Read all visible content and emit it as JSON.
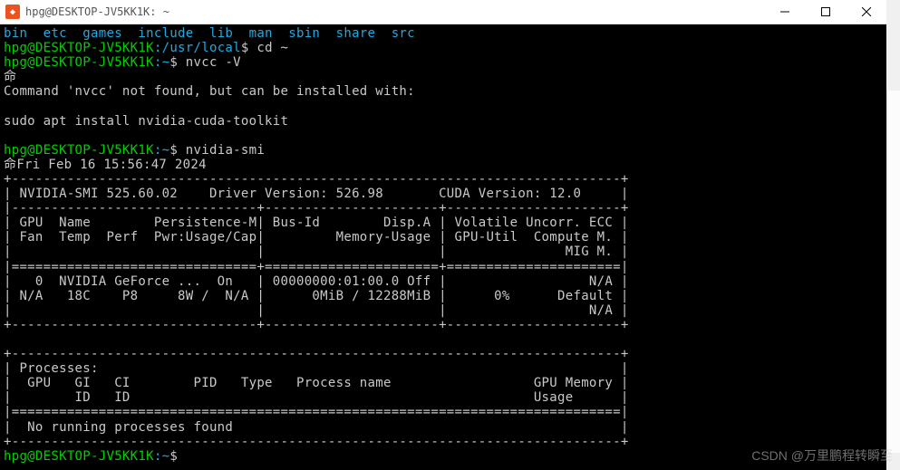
{
  "titlebar": {
    "icon_glyph": "◆",
    "title": "hpg@DESKTOP-JV5KK1K: ~"
  },
  "window_controls": {
    "minimize": "minimize",
    "maximize": "maximize",
    "close": "close"
  },
  "dirs_line": "bin  etc  games  include  lib  man  sbin  share  src",
  "prompts": [
    {
      "user": "hpg@DESKTOP-JV5KK1K",
      "path": ":/usr/local",
      "sep": "$ ",
      "cmd": "cd ~"
    },
    {
      "user": "hpg@DESKTOP-JV5KK1K",
      "path": ":~",
      "sep": "$ ",
      "cmd": "nvcc -V"
    }
  ],
  "left_cut": "命",
  "nvcc_error_line": "Command 'nvcc' not found, but can be installed with:",
  "install_line": "sudo apt install nvidia-cuda-toolkit",
  "prompt_smi": {
    "user": "hpg@DESKTOP-JV5KK1K",
    "path": ":~",
    "sep": "$ ",
    "cmd": "nvidia-smi"
  },
  "left_cut2": "命",
  "smi_date": "Fri Feb 16 15:56:47 2024",
  "border_top": "+-----------------------------------------------------------------------------+",
  "smi_header": "| NVIDIA-SMI 525.60.02    Driver Version: 526.98       CUDA Version: 12.0     |",
  "smi_sep": "|-------------------------------+----------------------+----------------------+",
  "smi_cols1": "| GPU  Name        Persistence-M| Bus-Id        Disp.A | Volatile Uncorr. ECC |",
  "smi_cols2": "| Fan  Temp  Perf  Pwr:Usage/Cap|         Memory-Usage | GPU-Util  Compute M. |",
  "smi_cols3": "|                               |                      |               MIG M. |",
  "smi_eq": "|===============================+======================+======================|",
  "smi_row1": "|   0  NVIDIA GeForce ...  On   | 00000000:01:00.0 Off |                  N/A |",
  "smi_row2": "| N/A   18C    P8     8W /  N/A |      0MiB / 12288MiB |      0%      Default |",
  "smi_row3": "|                               |                      |                  N/A |",
  "smi_bot": "+-------------------------------+----------------------+----------------------+",
  "proc_top": "+-----------------------------------------------------------------------------+",
  "proc_h1": "| Processes:                                                                  |",
  "proc_h2": "|  GPU   GI   CI        PID   Type   Process name                  GPU Memory |",
  "proc_h3": "|        ID   ID                                                   Usage      |",
  "proc_eq": "|=============================================================================|",
  "proc_none": "|  No running processes found                                                 |",
  "proc_bot": "+-----------------------------------------------------------------------------+",
  "prompt_end": {
    "user": "hpg@DESKTOP-JV5KK1K",
    "path": ":~",
    "sep": "$ ",
    "cmd": ""
  },
  "watermark": "CSDN @万里鹏程转瞬至"
}
